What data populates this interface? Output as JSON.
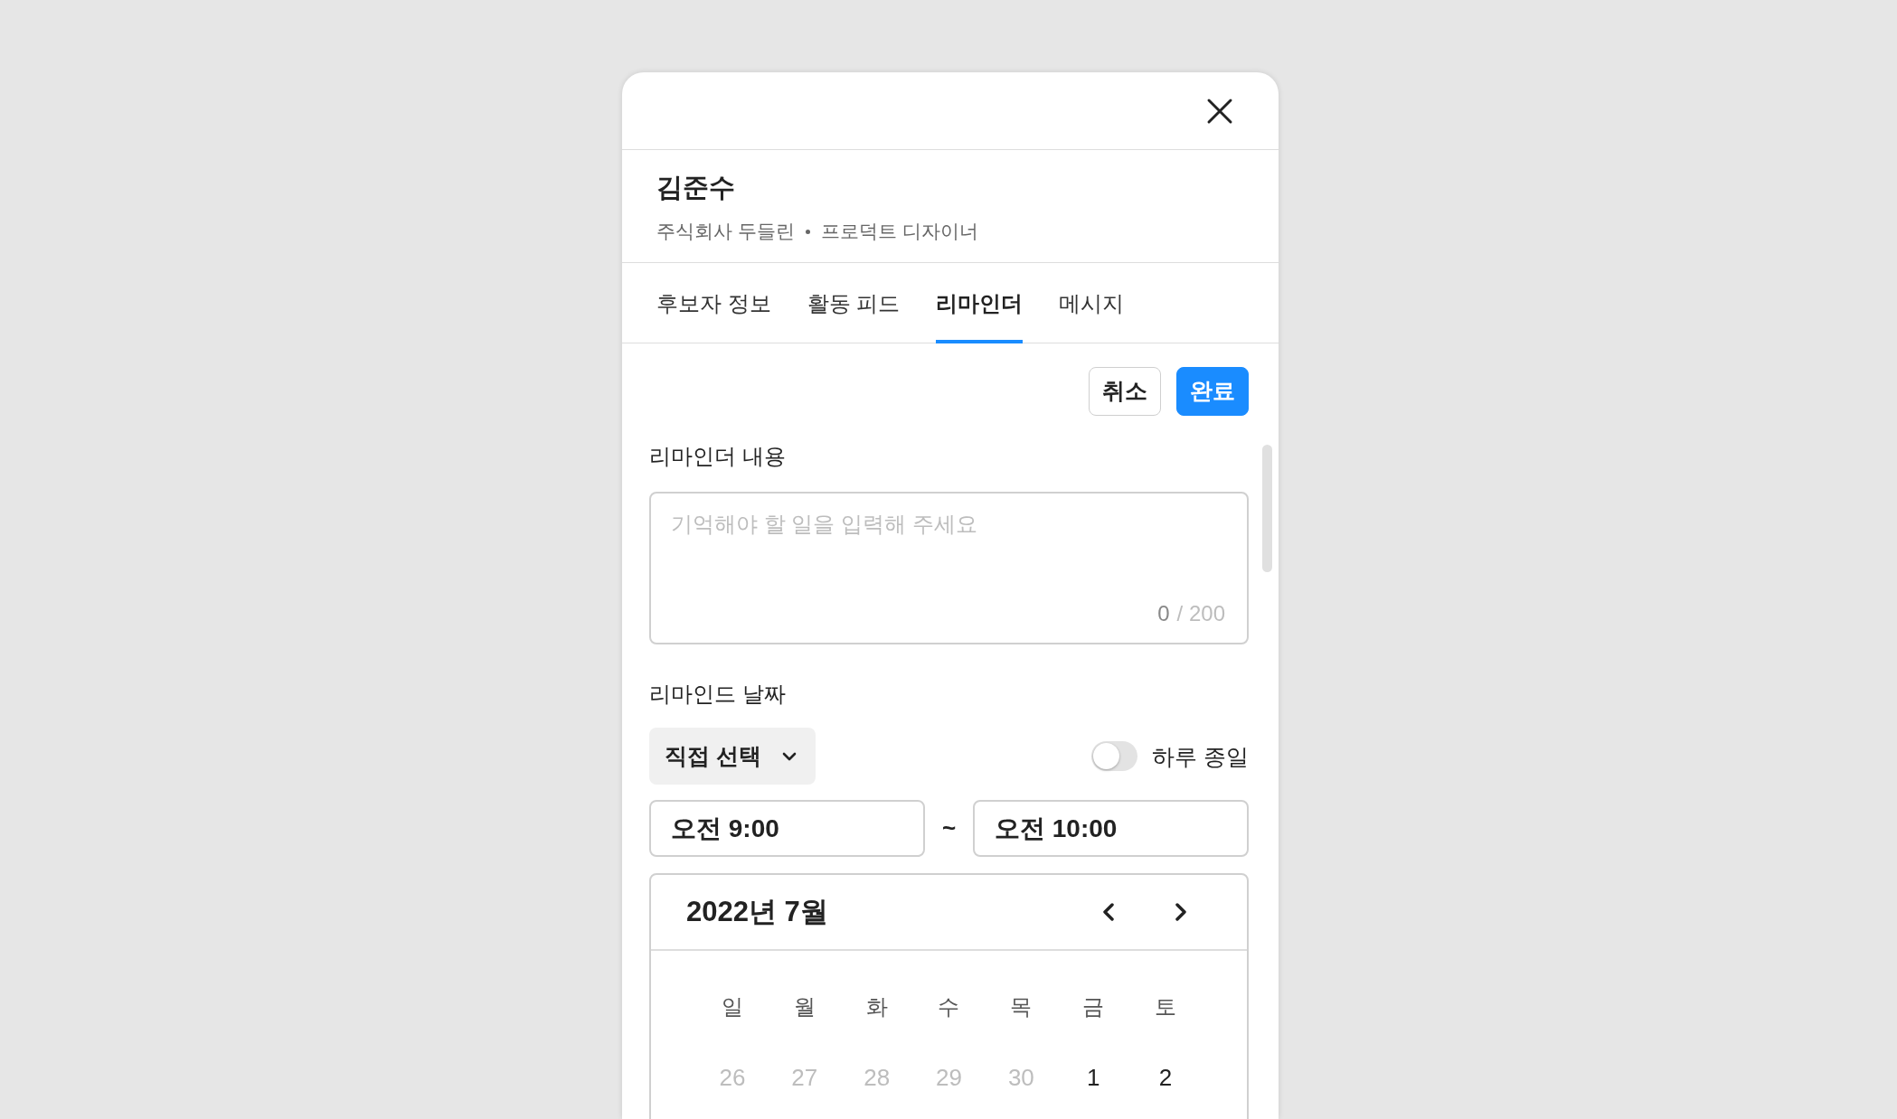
{
  "profile": {
    "name": "김준수",
    "company": "주식회사 두들린",
    "role": "프로덕트 디자이너"
  },
  "tabs": [
    {
      "label": "후보자 정보",
      "selected": false
    },
    {
      "label": "활동 피드",
      "selected": false
    },
    {
      "label": "리마인더",
      "selected": true
    },
    {
      "label": "메시지",
      "selected": false
    }
  ],
  "actions": [
    {
      "label": "취소",
      "kind": "secondary"
    },
    {
      "label": "완료",
      "kind": "primary"
    }
  ],
  "reminder_content": {
    "label": "리마인더 내용",
    "placeholder": "기억해야 할 일을 입력해 주세요",
    "count": "0",
    "limit": "/ 200"
  },
  "reminder_date": {
    "label": "리마인드 날짜",
    "mode": "직접 선택",
    "all_day": {
      "label": "하루 종일",
      "on": false
    },
    "start_time": "오전 9:00",
    "range_separator": "~",
    "end_time": "오전 10:00"
  },
  "calendar": {
    "title": "2022년 7월",
    "weekdays": [
      "일",
      "월",
      "화",
      "수",
      "목",
      "금",
      "토"
    ],
    "days": [
      {
        "label": "26",
        "in_month": false
      },
      {
        "label": "27",
        "in_month": false
      },
      {
        "label": "28",
        "in_month": false
      },
      {
        "label": "29",
        "in_month": false
      },
      {
        "label": "30",
        "in_month": false
      },
      {
        "label": "1",
        "in_month": true
      },
      {
        "label": "2",
        "in_month": true
      }
    ]
  }
}
